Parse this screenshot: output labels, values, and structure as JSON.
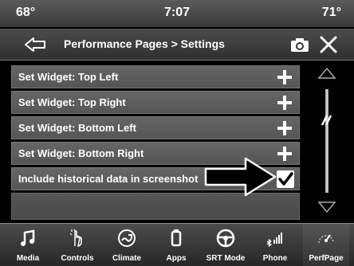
{
  "status": {
    "temp_left": "68°",
    "time": "7:07",
    "temp_right": "71°"
  },
  "header": {
    "title": "Performance Pages > Settings"
  },
  "settings": {
    "items": [
      {
        "label": "Set Widget: Top Left"
      },
      {
        "label": "Set Widget: Top Right"
      },
      {
        "label": "Set Widget: Bottom Left"
      },
      {
        "label": "Set Widget: Bottom Right"
      }
    ],
    "toggle": {
      "label": "Include historical data in screenshot",
      "checked": true
    }
  },
  "nav": {
    "items": [
      {
        "label": "Media",
        "icon": "music-note-icon"
      },
      {
        "label": "Controls",
        "icon": "hand-touch-icon"
      },
      {
        "label": "Climate",
        "icon": "climate-icon"
      },
      {
        "label": "Apps",
        "icon": "apps-icon"
      },
      {
        "label": "SRT Mode",
        "icon": "steering-wheel-icon"
      },
      {
        "label": "Phone",
        "icon": "bluetooth-signal-icon"
      },
      {
        "label": "PerfPage",
        "icon": "performance-gauge-icon"
      }
    ],
    "active": "PerfPage"
  },
  "colors": {
    "background": "#000000",
    "row": "#5e5e5e",
    "accent": "#ffffff"
  }
}
